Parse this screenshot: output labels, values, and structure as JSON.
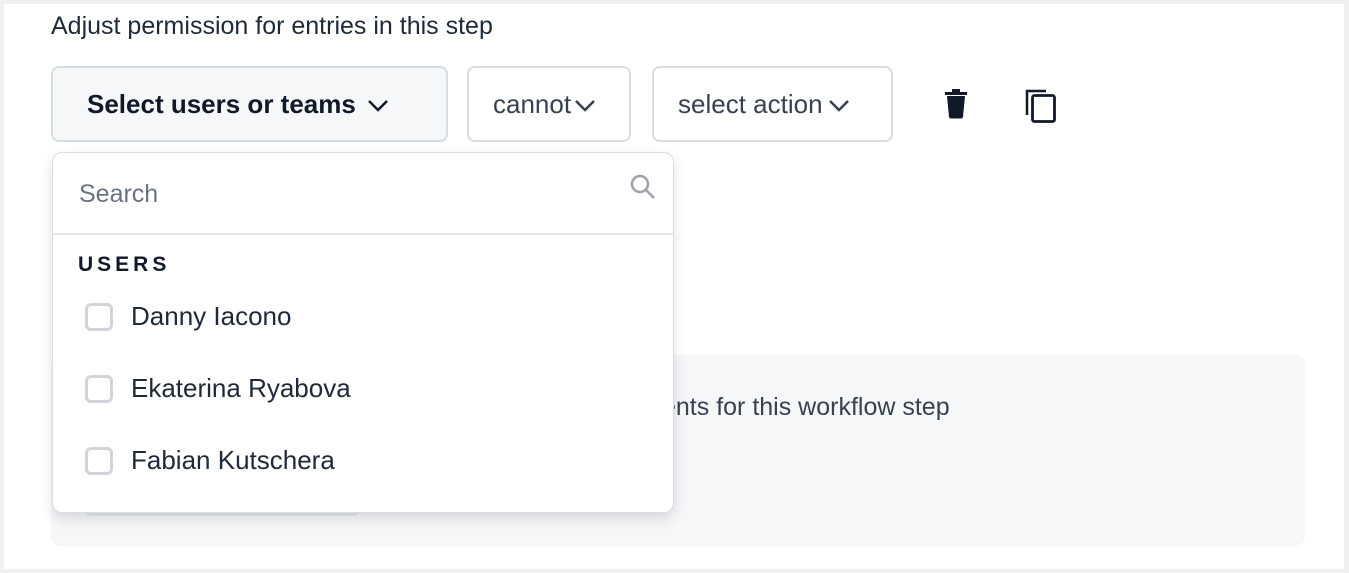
{
  "heading": "Adjust permission for entries in this step",
  "controls": {
    "users_select_label": "Select users or teams",
    "permission_select_value": "cannot",
    "action_select_label": "select action",
    "delete_icon": "trash-icon",
    "duplicate_icon": "copy-icon"
  },
  "background": {
    "text": "ents for this workflow step"
  },
  "dropdown": {
    "search_placeholder": "Search",
    "search_value": "",
    "section_label": "USERS",
    "items": [
      {
        "label": "Danny Iacono",
        "checked": false
      },
      {
        "label": "Ekaterina Ryabova",
        "checked": false
      },
      {
        "label": "Fabian Kutschera",
        "checked": false
      }
    ]
  }
}
